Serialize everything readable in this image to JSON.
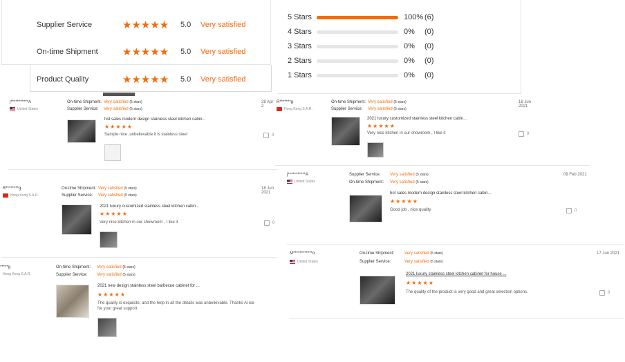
{
  "summary": [
    {
      "label": "Supplier Service",
      "score": "5.0",
      "text": "Very satisfied"
    },
    {
      "label": "On-time Shipment",
      "score": "5.0",
      "text": "Very satisfied"
    },
    {
      "label": "Product Quality",
      "score": "5.0",
      "text": "Very satisfied"
    }
  ],
  "star_glyphs": "★★★★★",
  "histogram": [
    {
      "label": "5 Stars",
      "fill": 1.0,
      "percent": "100%",
      "count": "(6)"
    },
    {
      "label": "4 Stars",
      "fill": 0,
      "percent": "0%",
      "count": "(0)"
    },
    {
      "label": "3 Stars",
      "fill": 0,
      "percent": "0%",
      "count": "(0)"
    },
    {
      "label": "2 Stars",
      "fill": 0,
      "percent": "0%",
      "count": "(0)"
    },
    {
      "label": "1 Stars",
      "fill": 0,
      "percent": "0%",
      "count": "(0)"
    }
  ],
  "reviews": [
    {
      "name": "j***********A",
      "country": "United States",
      "c1_label": "On-time Shipment:",
      "c1_value": "Very satisfied",
      "c1_stars": "(5 stars)",
      "c2_label": "Supplier Service:",
      "c2_value": "Very satisfied",
      "c2_stars": "(5 stars)",
      "date": "28 Apr 2",
      "title": "hot sales modern design stainless steel kitchen cabin...",
      "comment": "Sample nice ,unbelievable it is stainless steel",
      "likes": "0"
    },
    {
      "name": "R*******g",
      "country": "Hong Kong S.A.R.",
      "c1_label": "On-time Shipment:",
      "c1_value": "Very satisfied",
      "c1_stars": "(5 stars)",
      "c2_label": "Supplier Service:",
      "c2_value": "Very satisfied",
      "c2_stars": "(5 stars)",
      "date": "18 Jun 2021",
      "title": "2021 luxury customized stainless steel kitchen cabin...",
      "comment": "Very nice kitchen in our showroom , I like it",
      "likes": "0"
    },
    {
      "name": "R********g",
      "country": "Hong Kong S.A.R.",
      "c1_label": "On-time Shipment:",
      "c1_value": "Very satisfied",
      "c1_stars": "(5 stars)",
      "c2_label": "Supplier Service:",
      "c2_value": "Very satisfied",
      "c2_stars": "(5 stars)",
      "date": "18 Jun 2021",
      "title": "2021 luxury customized stainless steel kitchen cabin...",
      "comment": "Very nice kitchen in our showroom , I like it",
      "likes": "0"
    },
    {
      "name": "j***********A",
      "country": "United States",
      "c1_label": "Supplier Service:",
      "c1_value": "Very satisfied",
      "c1_stars": "(5 stars)",
      "c2_label": "On-time Shipment:",
      "c2_value": "Very satisfied",
      "c2_stars": "(5 stars)",
      "date": "09 Feb 2021",
      "title": "hot sales modern design stainless steel kitchen cabin...",
      "comment": "Good job , nice quality",
      "likes": "0"
    },
    {
      "name": "*****g",
      "country": "Hong Kong S.A.R.",
      "c1_label": "On-time Shipment:",
      "c1_value": "Very satisfied",
      "c1_stars": "(5 stars)",
      "c2_label": "Supplier Service:",
      "c2_value": "Very satisfied",
      "c2_stars": "(5 stars)",
      "date": "",
      "title": "2021 new design stainless steel barbecue cabinet for ...",
      "comment": "The quality is exquisite, and the help in all the details was unbelievable. Thanks Al ice for your great support",
      "likes": ""
    },
    {
      "name": "M************o",
      "country": "United States",
      "c1_label": "On-time Shipment:",
      "c1_value": "Very satisfied",
      "c1_stars": "(5 stars)",
      "c2_label": "Supplier Service:",
      "c2_value": "Very satisfied",
      "c2_stars": "(5 stars)",
      "date": "17 Jun 2021",
      "title": "2021 luxury stainless steel kitchen cabinet for house ...",
      "comment": "The quality of the product is very good and great selection options.",
      "likes": "0"
    }
  ]
}
